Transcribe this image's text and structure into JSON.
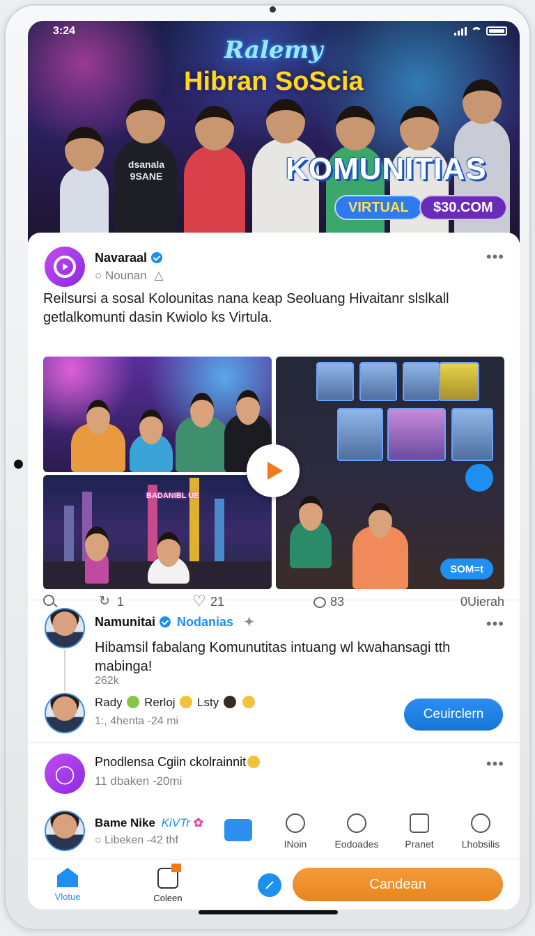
{
  "status": {
    "time": "3:24"
  },
  "hero": {
    "brand": "Ralemy",
    "title": "Hibran SoScia",
    "headline": "KOMUNITIAS",
    "pill_left": "VIRTUAL",
    "pill_right": "$30.COM",
    "shirt_text": "dsanala 9SANE"
  },
  "post1": {
    "author": "Navaraal",
    "handle": "Nounan",
    "body": "Reilsursi a sosal Kolounitas nana keap Seoluang Hivaitanr slslkall getlalkomunti dasin Kwiolo ks Virtula.",
    "city_sign": "BADANIBL UE",
    "live_label": "SOM=t",
    "actions": {
      "reposts": "1",
      "likes": "21",
      "comments": "83",
      "views": "0Uierah"
    },
    "accent": "#f07a1a"
  },
  "post2": {
    "author": "Namunitai",
    "tag": "Nodanias",
    "body": "Hibamsil fabalang Komunutitas intuang wl kwahansagi tth mabinga!",
    "count": "262k",
    "reactions": {
      "name1": "Rady",
      "name2": "Rerloj",
      "name3": "Lsty"
    },
    "meta": "1:, 4henta -24 mi",
    "button": "Ceuirclern"
  },
  "post3": {
    "title": "Pnodlensa Cgiin ckolrainnit",
    "meta": "11 dbaken -20mi"
  },
  "quick_row": {
    "author": "Bame Nike",
    "tag": "KiVTr",
    "meta": "Libeken -42 thf",
    "items": [
      "INoin",
      "Eodoades",
      "Pranet",
      "Lhobsilis"
    ]
  },
  "tabs": {
    "home": "Vlotue",
    "collection": "Coleen",
    "cta": "Candean"
  },
  "colors": {
    "primary": "#1d8ff0",
    "cta": "#e8861f",
    "brand_purple": "#8a2be2"
  }
}
